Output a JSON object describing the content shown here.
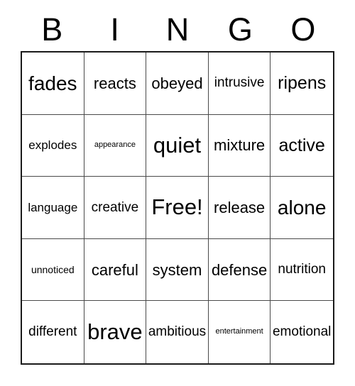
{
  "card": {
    "title": "Bingo Card",
    "header_letters": [
      "B",
      "I",
      "N",
      "G",
      "O"
    ],
    "grid_size": "5x5",
    "free_space_label": "Free!",
    "colors": {
      "background": "#ffffff",
      "text": "#000000",
      "outer_border": "#1a1a1a",
      "inner_border": "#4a4a4a"
    },
    "columns": [
      {
        "letter": "B",
        "cells": [
          {
            "text": "fades",
            "size": "fs-xl"
          },
          {
            "text": "explodes",
            "size": "fs-xs"
          },
          {
            "text": "language",
            "size": "fs-xs"
          },
          {
            "text": "unnoticed",
            "size": "fs-xxs"
          },
          {
            "text": "different",
            "size": "fs-s"
          }
        ]
      },
      {
        "letter": "I",
        "cells": [
          {
            "text": "reacts",
            "size": "fs-m"
          },
          {
            "text": "appearance",
            "size": "fs-tiny"
          },
          {
            "text": "creative",
            "size": "fs-s"
          },
          {
            "text": "careful",
            "size": "fs-m"
          },
          {
            "text": "brave",
            "size": "fs-xxl"
          }
        ]
      },
      {
        "letter": "N",
        "cells": [
          {
            "text": "obeyed",
            "size": "fs-m"
          },
          {
            "text": "quiet",
            "size": "fs-xxl"
          },
          {
            "text": "Free!",
            "size": "fs-xxl"
          },
          {
            "text": "system",
            "size": "fs-m"
          },
          {
            "text": "ambitious",
            "size": "fs-s"
          }
        ]
      },
      {
        "letter": "G",
        "cells": [
          {
            "text": "intrusive",
            "size": "fs-s"
          },
          {
            "text": "mixture",
            "size": "fs-m"
          },
          {
            "text": "release",
            "size": "fs-m"
          },
          {
            "text": "defense",
            "size": "fs-m"
          },
          {
            "text": "entertainment",
            "size": "fs-tiny"
          }
        ]
      },
      {
        "letter": "O",
        "cells": [
          {
            "text": "ripens",
            "size": "fs-l"
          },
          {
            "text": "active",
            "size": "fs-l"
          },
          {
            "text": "alone",
            "size": "fs-xl"
          },
          {
            "text": "nutrition",
            "size": "fs-s"
          },
          {
            "text": "emotional",
            "size": "fs-s"
          }
        ]
      }
    ]
  }
}
